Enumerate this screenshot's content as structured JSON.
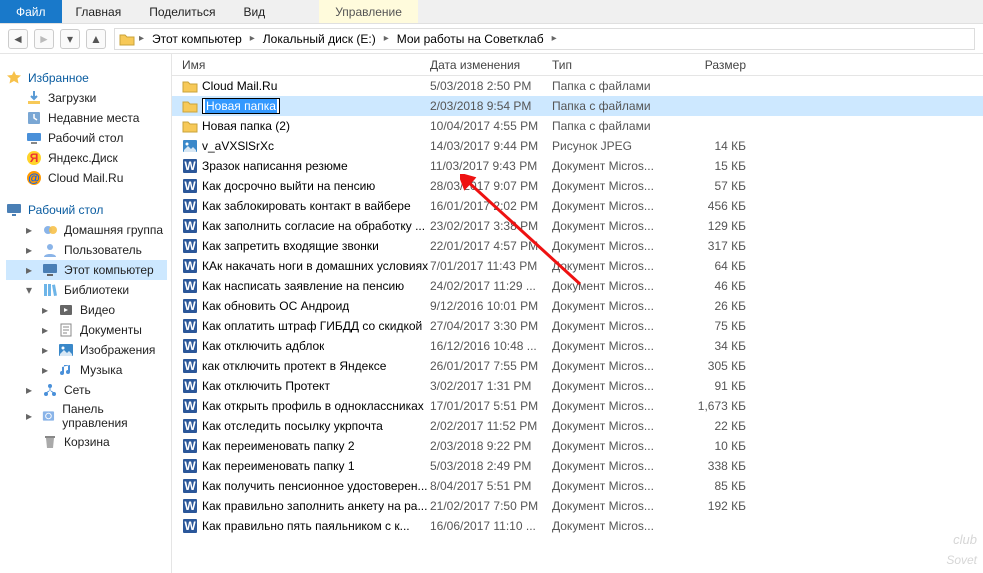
{
  "ribbon": {
    "file": "Файл",
    "tabs": [
      "Главная",
      "Поделиться",
      "Вид"
    ],
    "manage": "Управление"
  },
  "nav_arrows": {
    "back": "◄",
    "forward": "►",
    "dropdown": "▾",
    "up": "▲"
  },
  "breadcrumb": {
    "items": [
      "Этот компьютер",
      "Локальный диск (E:)",
      "Мои работы на Советклаб"
    ]
  },
  "navpane": {
    "favorites_title": "Избранное",
    "favorites": [
      {
        "label": "Загрузки",
        "icon": "download"
      },
      {
        "label": "Недавние места",
        "icon": "recent"
      },
      {
        "label": "Рабочий стол",
        "icon": "desktop"
      },
      {
        "label": "Яндекс.Диск",
        "icon": "yandex"
      },
      {
        "label": "Cloud Mail.Ru",
        "icon": "mailru"
      }
    ],
    "desktop_title": "Рабочий стол",
    "desktop": [
      {
        "label": "Домашняя группа",
        "icon": "homegroup",
        "toggle": "▸"
      },
      {
        "label": "Пользователь",
        "icon": "user",
        "toggle": "▸"
      },
      {
        "label": "Этот компьютер",
        "icon": "pc",
        "toggle": "▸",
        "selected": true
      },
      {
        "label": "Библиотеки",
        "icon": "libs",
        "toggle": "▾",
        "children": [
          {
            "label": "Видео",
            "icon": "video",
            "toggle": "▸"
          },
          {
            "label": "Документы",
            "icon": "docs",
            "toggle": "▸"
          },
          {
            "label": "Изображения",
            "icon": "images",
            "toggle": "▸"
          },
          {
            "label": "Музыка",
            "icon": "music",
            "toggle": "▸"
          }
        ]
      },
      {
        "label": "Сеть",
        "icon": "network",
        "toggle": "▸"
      },
      {
        "label": "Панель управления",
        "icon": "cpl",
        "toggle": "▸"
      },
      {
        "label": "Корзина",
        "icon": "bin"
      }
    ]
  },
  "columns": {
    "name": "Имя",
    "date": "Дата изменения",
    "type": "Тип",
    "size": "Размер"
  },
  "rename_value": "Новая папка",
  "rows": [
    {
      "icon": "folder",
      "name": "Cloud Mail.Ru",
      "date": "5/03/2018 2:50 PM",
      "type": "Папка с файлами",
      "size": ""
    },
    {
      "icon": "folder",
      "name": "",
      "date": "2/03/2018 9:54 PM",
      "type": "Папка с файлами",
      "size": "",
      "renaming": true,
      "selected": true
    },
    {
      "icon": "folder",
      "name": "Новая папка (2)",
      "date": "10/04/2017 4:55 PM",
      "type": "Папка с файлами",
      "size": ""
    },
    {
      "icon": "image",
      "name": "v_aVXSlSrXc",
      "date": "14/03/2017 9:44 PM",
      "type": "Рисунок JPEG",
      "size": "14 КБ"
    },
    {
      "icon": "word",
      "name": "Зразок написання резюме",
      "date": "11/03/2017 9:43 PM",
      "type": "Документ Micros...",
      "size": "15 КБ"
    },
    {
      "icon": "word",
      "name": "Как досрочно выйти на пенсию",
      "date": "28/03/2017 9:07 PM",
      "type": "Документ Micros...",
      "size": "57 КБ"
    },
    {
      "icon": "word",
      "name": "Как заблокировать контакт в вайбере",
      "date": "16/01/2017 2:02 PM",
      "type": "Документ Micros...",
      "size": "456 КБ"
    },
    {
      "icon": "word",
      "name": "Как заполнить согласие на обработку ...",
      "date": "23/02/2017 3:38 PM",
      "type": "Документ Micros...",
      "size": "129 КБ"
    },
    {
      "icon": "word",
      "name": "Как запретить входящие звонки",
      "date": "22/01/2017 4:57 PM",
      "type": "Документ Micros...",
      "size": "317 КБ"
    },
    {
      "icon": "word",
      "name": "КАк накачать ноги в домашних условиях",
      "date": "7/01/2017 11:43 PM",
      "type": "Документ Micros...",
      "size": "64 КБ"
    },
    {
      "icon": "word",
      "name": "Как насписать заявление на пенсию",
      "date": "24/02/2017 11:29 ...",
      "type": "Документ Micros...",
      "size": "46 КБ"
    },
    {
      "icon": "word",
      "name": "Как обновить ОС Андроид",
      "date": "9/12/2016 10:01 PM",
      "type": "Документ Micros...",
      "size": "26 КБ"
    },
    {
      "icon": "word",
      "name": "Как оплатить штраф ГИБДД со скидкой",
      "date": "27/04/2017 3:30 PM",
      "type": "Документ Micros...",
      "size": "75 КБ"
    },
    {
      "icon": "word",
      "name": "Как отключить адблок",
      "date": "16/12/2016 10:48 ...",
      "type": "Документ Micros...",
      "size": "34 КБ"
    },
    {
      "icon": "word",
      "name": "как отключить протект в Яндексе",
      "date": "26/01/2017 7:55 PM",
      "type": "Документ Micros...",
      "size": "305 КБ"
    },
    {
      "icon": "word",
      "name": "Как отключить Протект",
      "date": "3/02/2017 1:31 PM",
      "type": "Документ Micros...",
      "size": "91 КБ"
    },
    {
      "icon": "word",
      "name": "Как открыть профиль в одноклассниках",
      "date": "17/01/2017 5:51 PM",
      "type": "Документ Micros...",
      "size": "1,673 КБ"
    },
    {
      "icon": "word",
      "name": "Как отследить посылку укрпочта",
      "date": "2/02/2017 11:52 PM",
      "type": "Документ Micros...",
      "size": "22 КБ"
    },
    {
      "icon": "word",
      "name": "Как переименовать папку 2",
      "date": "2/03/2018 9:22 PM",
      "type": "Документ Micros...",
      "size": "10 КБ"
    },
    {
      "icon": "word",
      "name": "Как переименовать папку 1",
      "date": "5/03/2018 2:49 PM",
      "type": "Документ Micros...",
      "size": "338 КБ"
    },
    {
      "icon": "word",
      "name": "Как получить пенсионное удостоверен...",
      "date": "8/04/2017 5:51 PM",
      "type": "Документ Micros...",
      "size": "85 КБ"
    },
    {
      "icon": "word",
      "name": "Как правильно заполнить анкету на ра...",
      "date": "21/02/2017 7:50 PM",
      "type": "Документ Micros...",
      "size": "192 КБ"
    },
    {
      "icon": "word",
      "name": "Как правильно пять паяльником с к...",
      "date": "16/06/2017 11:10 ...",
      "type": "Документ Micros...",
      "size": ""
    }
  ],
  "watermark": {
    "line1": "club",
    "line2": "Sovet"
  }
}
